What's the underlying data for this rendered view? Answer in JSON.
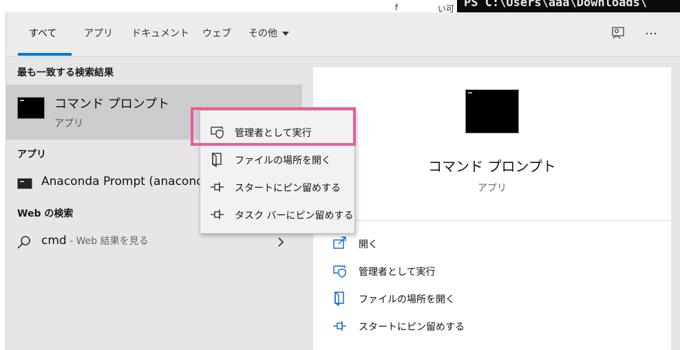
{
  "background": {
    "terminal_text": "PS C:\\Users\\aaa\\Downloads\\",
    "fragments": [
      "f",
      "い可"
    ]
  },
  "tabs": [
    {
      "label": "すべて"
    },
    {
      "label": "アプリ"
    },
    {
      "label": "ドキュメント"
    },
    {
      "label": "ウェブ"
    },
    {
      "label": "その他"
    }
  ],
  "header_icons": [
    "feedback-icon",
    "more-options-icon"
  ],
  "header_more_label": "…",
  "left": {
    "best_match_title": "最も一致する検索結果",
    "best_match": {
      "name": "コマンド プロンプト",
      "type": "アプリ"
    },
    "apps_title": "アプリ",
    "apps": [
      {
        "name": "Anaconda Prompt (anacond"
      }
    ],
    "web_title": "Web の検索",
    "web_query": "cmd",
    "web_suffix": " - Web 結果を見る"
  },
  "right": {
    "app_name": "コマンド プロンプト",
    "app_type": "アプリ",
    "actions": [
      {
        "label": "開く",
        "icon": "open-icon"
      },
      {
        "label": "管理者として実行",
        "icon": "shield-icon"
      },
      {
        "label": "ファイルの場所を開く",
        "icon": "file-location-icon"
      },
      {
        "label": "スタートにピン留めする",
        "icon": "pin-icon"
      }
    ]
  },
  "context_menu": {
    "items": [
      {
        "label": "管理者として実行",
        "icon": "shield-icon"
      },
      {
        "label": "ファイルの場所を開く",
        "icon": "file-location-icon"
      },
      {
        "label": "スタートにピン留めする",
        "icon": "pin-icon"
      },
      {
        "label": "タスク バーにピン留めする",
        "icon": "pin-icon"
      }
    ]
  },
  "colors": {
    "accent": "#0078d7",
    "highlight": "#ea5c99",
    "selected_row": "#cccccc",
    "panel": "#e6e6e6"
  }
}
